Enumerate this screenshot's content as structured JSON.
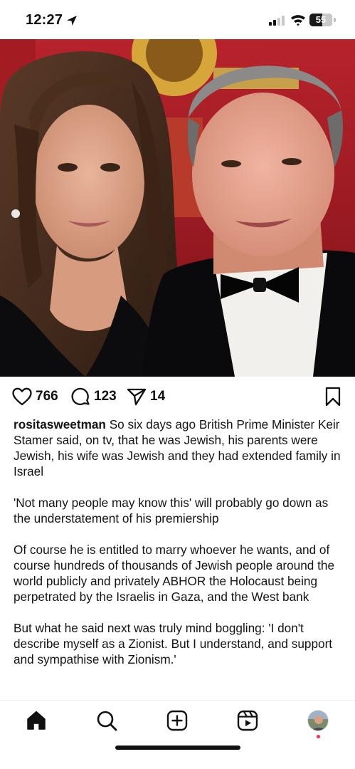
{
  "status_bar": {
    "time": "12:27",
    "battery_percent": "55",
    "icons": [
      "location-arrow-icon",
      "cellular-signal-icon",
      "wifi-icon",
      "battery-icon"
    ]
  },
  "post": {
    "photo_icon": "post-photo",
    "likes": "766",
    "comments": "123",
    "shares": "14",
    "icons": [
      "heart-icon",
      "comment-icon",
      "send-icon",
      "bookmark-icon"
    ]
  },
  "caption": {
    "username": "rositasweetman",
    "p1": "So six days ago British Prime Minister Keir Stamer said, on tv, that he was Jewish, his parents were Jewish, his wife was Jewish and they had extended family in Israel",
    "p2": "'Not many people may know this' will probably go down as the understatement of his premiership",
    "p3": "Of course he is entitled to marry whoever he wants, and of course hundreds of thousands of Jewish people around the world publicly and privately ABHOR the Holocaust being perpetrated by the Israelis in Gaza, and the West bank",
    "p4": "But what he said next was truly mind boggling: 'I don't describe myself as a Zionist. But I understand, and support and sympathise with Zionism.'"
  },
  "nav": {
    "items": [
      "home-icon",
      "search-icon",
      "create-icon",
      "reels-icon",
      "profile-avatar"
    ]
  },
  "colors": {
    "text": "#111111",
    "notification_dot": "#ff2d55",
    "background": "#ffffff"
  }
}
